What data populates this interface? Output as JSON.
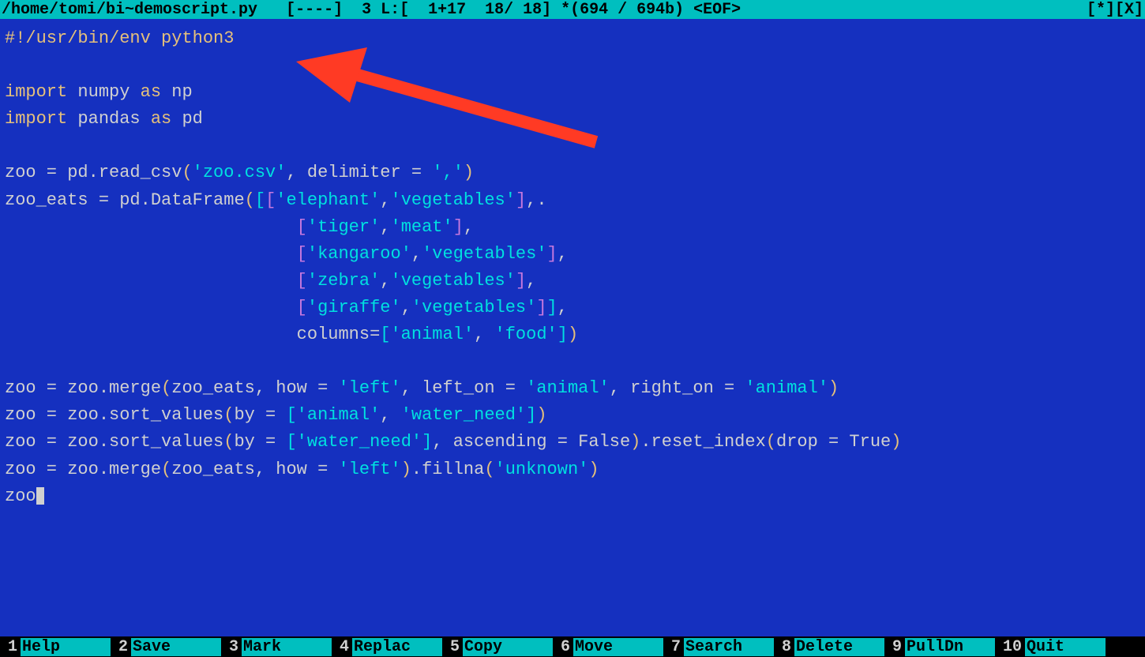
{
  "status_bar": {
    "path": "/home/tomi/bi~demoscript.py",
    "modified_flags": "[----]",
    "position_info": "3 L:[  1+17  18/ 18] *(694 / 694b) <EOF>",
    "indicators": "[*][X]"
  },
  "code": {
    "line1_shebang": "#!/usr/bin/env python3",
    "line3_import": "import",
    "line3_numpy": " numpy ",
    "line3_as": "as",
    "line3_np": " np",
    "line4_import": "import",
    "line4_pandas": " pandas ",
    "line4_as": "as",
    "line4_pd": " pd",
    "line6_pre": "zoo = pd.read_csv",
    "line6_paren_open": "(",
    "line6_str1": "'zoo.csv'",
    "line6_mid": ", delimiter = ",
    "line6_str2": "','",
    "line6_paren_close": ")",
    "line7_pre": "zoo_eats = pd.DataFrame",
    "line7_b1": "(",
    "line7_b2": "[",
    "line7_b3": "[",
    "line7_str1": "'elephant'",
    "line7_comma1": ",",
    "line7_str2": "'vegetables'",
    "line7_b3c": "]",
    "line7_tail": ",.",
    "line8_indent": "                            ",
    "line8_b": "[",
    "line8_str1": "'tiger'",
    "line8_comma": ",",
    "line8_str2": "'meat'",
    "line8_bc": "]",
    "line8_tail": ",",
    "line9_indent": "                            ",
    "line9_b": "[",
    "line9_str1": "'kangaroo'",
    "line9_comma": ",",
    "line9_str2": "'vegetables'",
    "line9_bc": "]",
    "line9_tail": ",",
    "line10_indent": "                            ",
    "line10_b": "[",
    "line10_str1": "'zebra'",
    "line10_comma": ",",
    "line10_str2": "'vegetables'",
    "line10_bc": "]",
    "line10_tail": ",",
    "line11_indent": "                            ",
    "line11_b": "[",
    "line11_str1": "'giraffe'",
    "line11_comma": ",",
    "line11_str2": "'vegetables'",
    "line11_bc": "]",
    "line11_b2c": "]",
    "line11_tail": ",",
    "line12_indent": "                            columns=",
    "line12_b": "[",
    "line12_str1": "'animal'",
    "line12_mid": ", ",
    "line12_str2": "'food'",
    "line12_bc": "]",
    "line12_paren_close": ")",
    "line14_pre": "zoo = zoo.merge",
    "line14_paren_open": "(",
    "line14_arg1": "zoo_eats, how = ",
    "line14_str1": "'left'",
    "line14_mid1": ", left_on = ",
    "line14_str2": "'animal'",
    "line14_mid2": ", right_on = ",
    "line14_str3": "'animal'",
    "line14_paren_close": ")",
    "line15_pre": "zoo = zoo.sort_values",
    "line15_paren_open": "(",
    "line15_arg": "by = ",
    "line15_b": "[",
    "line15_str1": "'animal'",
    "line15_mid": ", ",
    "line15_str2": "'water_need'",
    "line15_bc": "]",
    "line15_paren_close": ")",
    "line16_pre": "zoo = zoo.sort_values",
    "line16_paren_open": "(",
    "line16_arg": "by = ",
    "line16_b": "[",
    "line16_str1": "'water_need'",
    "line16_bc": "]",
    "line16_mid": ", ascending = False",
    "line16_paren_close": ")",
    "line16_reset": ".reset_index",
    "line16_paren2_open": "(",
    "line16_drop": "drop = True",
    "line16_paren2_close": ")",
    "line17_pre": "zoo = zoo.merge",
    "line17_paren_open": "(",
    "line17_arg": "zoo_eats, how = ",
    "line17_str1": "'left'",
    "line17_paren_close": ")",
    "line17_fillna": ".fillna",
    "line17_paren2_open": "(",
    "line17_str2": "'unknown'",
    "line17_paren2_close": ")",
    "line18": "zoo"
  },
  "function_keys": [
    {
      "num": "1",
      "label": "Help"
    },
    {
      "num": "2",
      "label": "Save"
    },
    {
      "num": "3",
      "label": "Mark"
    },
    {
      "num": "4",
      "label": "Replac"
    },
    {
      "num": "5",
      "label": "Copy"
    },
    {
      "num": "6",
      "label": "Move"
    },
    {
      "num": "7",
      "label": "Search"
    },
    {
      "num": "8",
      "label": "Delete"
    },
    {
      "num": "9",
      "label": "PullDn"
    },
    {
      "num": "10",
      "label": "Quit"
    }
  ]
}
